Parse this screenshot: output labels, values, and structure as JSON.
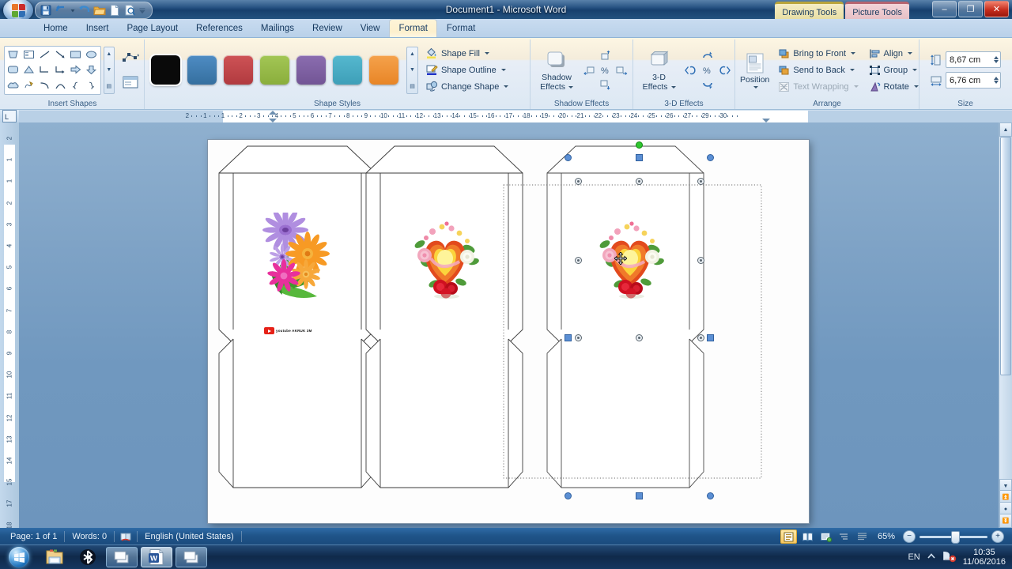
{
  "window": {
    "title": "Document1 - Microsoft Word",
    "contextual_tabs": [
      {
        "label": "Drawing Tools",
        "type": "drawing"
      },
      {
        "label": "Picture Tools",
        "type": "picture"
      }
    ],
    "controls": {
      "minimize": "–",
      "restore": "❐",
      "close": "✕"
    },
    "quick_access": [
      "save-icon",
      "undo-icon",
      "undo-dropdown-icon",
      "redo-icon",
      "open-icon",
      "new-icon",
      "print-preview-icon",
      "qat-customize-icon"
    ]
  },
  "tabs": [
    {
      "label": "Home",
      "active": false
    },
    {
      "label": "Insert",
      "active": false
    },
    {
      "label": "Page Layout",
      "active": false
    },
    {
      "label": "References",
      "active": false
    },
    {
      "label": "Mailings",
      "active": false
    },
    {
      "label": "Review",
      "active": false
    },
    {
      "label": "View",
      "active": false
    },
    {
      "label": "Format",
      "active": true
    },
    {
      "label": "Format",
      "active": false
    }
  ],
  "ribbon": {
    "groups": [
      {
        "id": "insert-shapes",
        "title": "Insert Shapes"
      },
      {
        "id": "shape-styles",
        "title": "Shape Styles"
      },
      {
        "id": "shadow-effects",
        "title": "Shadow Effects"
      },
      {
        "id": "three-d-effects",
        "title": "3-D Effects"
      },
      {
        "id": "arrange",
        "title": "Arrange"
      },
      {
        "id": "size",
        "title": "Size"
      }
    ],
    "shape_styles": {
      "swatches": [
        {
          "name": "black",
          "color": "#0a0a0a",
          "selected": true
        },
        {
          "name": "blue",
          "color": "#3d7ab5",
          "selected": false
        },
        {
          "name": "red",
          "color": "#c1454a",
          "selected": false
        },
        {
          "name": "green",
          "color": "#98bc48",
          "selected": false
        },
        {
          "name": "purple",
          "color": "#8064a2",
          "selected": false
        },
        {
          "name": "teal",
          "color": "#4bacc6",
          "selected": false
        },
        {
          "name": "orange",
          "color": "#f0943c",
          "selected": false
        }
      ],
      "commands": [
        {
          "label": "Shape Fill",
          "icon": "paint-bucket-icon",
          "disabled": false
        },
        {
          "label": "Shape Outline",
          "icon": "pencil-outline-icon",
          "disabled": false
        },
        {
          "label": "Change Shape",
          "icon": "change-shape-icon",
          "disabled": false
        }
      ]
    },
    "shadow_effects": {
      "button_label_line1": "Shadow",
      "button_label_line2": "Effects"
    },
    "three_d_effects": {
      "button_label_line1": "3-D",
      "button_label_line2": "Effects"
    },
    "arrange": {
      "position_label": "Position",
      "commands": [
        {
          "label": "Bring to Front",
          "disabled": false
        },
        {
          "label": "Send to Back",
          "disabled": false
        },
        {
          "label": "Text Wrapping",
          "disabled": true
        },
        {
          "label": "Align",
          "disabled": false
        },
        {
          "label": "Group",
          "disabled": false
        },
        {
          "label": "Rotate",
          "disabled": false
        }
      ]
    },
    "size": {
      "height": {
        "label": "shape-height",
        "value": "8,67 cm"
      },
      "width": {
        "label": "shape-width",
        "value": "6,76 cm"
      }
    }
  },
  "rulers": {
    "horizontal": [
      "2",
      "1",
      "1",
      "2",
      "3",
      "4",
      "5",
      "6",
      "7",
      "8",
      "9",
      "10",
      "11",
      "12",
      "13",
      "14",
      "15",
      "16",
      "17",
      "18",
      "19",
      "20",
      "21",
      "22",
      "23",
      "24",
      "25",
      "26",
      "27",
      "29",
      "30"
    ],
    "vertical": [
      "2",
      "1",
      "1",
      "2",
      "3",
      "4",
      "5",
      "6",
      "7",
      "8",
      "9",
      "10",
      "11",
      "12",
      "13",
      "14",
      "15",
      "17",
      "18"
    ],
    "corner_marker": "L"
  },
  "document": {
    "envelopes": [
      {
        "id": "envelope-left",
        "clipart": "flower-bouquet-clipart",
        "watermark": {
          "text": "youtube AKRUK 3M",
          "icon": "youtube-icon"
        }
      },
      {
        "id": "envelope-middle",
        "clipart": "heart-flowers-clipart"
      },
      {
        "id": "envelope-right",
        "clipart": "heart-flowers-clipart",
        "selected": true
      }
    ],
    "selection": {
      "state": "selected",
      "handle_colors": {
        "resize": "#5b8fd4",
        "rotate": "#2ec62e",
        "vertex": "#e8edf2"
      }
    }
  },
  "status_bar": {
    "page": "Page: 1 of 1",
    "words": "Words: 0",
    "proofing_icon": "proofing-errors-icon",
    "language": "English (United States)",
    "views": [
      {
        "name": "print-layout-view",
        "active": true
      },
      {
        "name": "full-screen-reading-view",
        "active": false
      },
      {
        "name": "web-layout-view",
        "active": false
      },
      {
        "name": "outline-view",
        "active": false
      },
      {
        "name": "draft-view",
        "active": false
      }
    ],
    "zoom": "65%",
    "zoom_out": "−",
    "zoom_in": "+"
  },
  "taskbar": {
    "start": "start-orb-icon",
    "items": [
      {
        "name": "windows-explorer-icon",
        "state": "pinned"
      },
      {
        "name": "bluetooth-icon",
        "state": "pinned"
      },
      {
        "name": "window-app-icon",
        "state": "open"
      },
      {
        "name": "microsoft-word-icon",
        "state": "active"
      },
      {
        "name": "window-app-icon-2",
        "state": "open"
      }
    ],
    "tray": {
      "language": "EN",
      "show_hidden": "show-hidden-icons-icon",
      "network": "network-error-icon",
      "time": "10:35",
      "date": "11/06/2016"
    }
  }
}
